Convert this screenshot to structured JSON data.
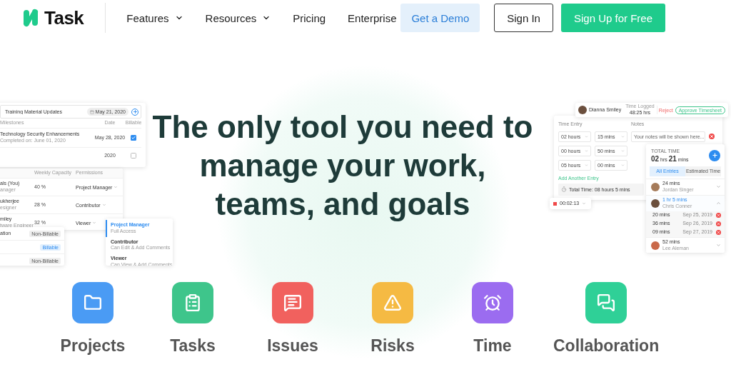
{
  "header": {
    "logo": {
      "text": "Task"
    },
    "nav": [
      {
        "label": "Features",
        "dropdown": true
      },
      {
        "label": "Resources",
        "dropdown": true
      },
      {
        "label": "Pricing",
        "dropdown": false
      },
      {
        "label": "Enterprise",
        "dropdown": false
      }
    ],
    "buttons": [
      {
        "label": "Get a Demo",
        "kind": "secondary"
      },
      {
        "label": "Sign In",
        "kind": "outline"
      },
      {
        "label": "Sign Up for Free",
        "kind": "primary"
      }
    ]
  },
  "hero": {
    "heading_lines": [
      "The only tool you need to",
      "manage your work,",
      "teams, and goals"
    ]
  },
  "left_mockup": {
    "milestones": {
      "task_field": "Training Material Updates",
      "date_chip": "May 21, 2020",
      "columns": [
        "Milestones",
        "Date",
        "Billable"
      ],
      "rows": [
        {
          "title": "Technology Security Enhancements",
          "subtitle": "Completed on: June 01, 2020",
          "date": "May 28, 2020",
          "billable": true
        },
        {
          "date": "2020",
          "billable": false
        }
      ]
    },
    "team": {
      "columns": [
        "Weekly Capacity",
        "Permissions"
      ],
      "rows": [
        {
          "name": "als (You)",
          "role": "anager",
          "capacity": "40 %",
          "permission": "Project Manager"
        },
        {
          "name": "ukherjee",
          "role": "esigner",
          "capacity": "28 %",
          "permission": "Contributor"
        },
        {
          "name": "miley",
          "role": "tware Engineer",
          "capacity": "32 %",
          "permission": "Viewer"
        }
      ]
    },
    "billing": [
      {
        "label": "ation",
        "badge": "Non-Billable",
        "billable": false
      },
      {
        "badge": "Billable",
        "billable": true
      },
      {
        "badge": "Non-Billable",
        "billable": false
      }
    ],
    "permission_menu": [
      {
        "title": "Project Manager",
        "description": "Full Access",
        "selected": true
      },
      {
        "title": "Contributor",
        "description": "Can Edit & Add Comments",
        "selected": false
      },
      {
        "title": "Viewer",
        "description": "Can View & Add Comments",
        "selected": false
      }
    ]
  },
  "right_mockup": {
    "approval": {
      "name": "Dianna Smiley",
      "logged_label": "Time Logged",
      "logged_value": "48:25 hrs",
      "reject": "Reject",
      "approve": "Approve Timesheet"
    },
    "entry_form": {
      "time_label": "Time Entry",
      "notes_label": "Notes",
      "rows": [
        {
          "hours": "02 hours",
          "mins": "15 mins"
        },
        {
          "hours": "00 hours",
          "mins": "50 mins"
        },
        {
          "hours": "05 hours",
          "mins": "00 mins"
        }
      ],
      "notes_placeholder": "Your notes will be shown here...",
      "add_entry": "Add Another Entry",
      "total": "Total Time: 08 hours 5 mins"
    },
    "timer": "00:02:13",
    "summary": {
      "label": "TOTAL TIME",
      "hours": "02",
      "hours_unit": "hrs",
      "mins": "21",
      "mins_unit": "mins",
      "tabs": [
        {
          "label": "All Entries",
          "selected": true
        },
        {
          "label": "Estimated Time",
          "selected": false
        }
      ],
      "entries": [
        {
          "duration": "24 mins",
          "name": "Jordan Singer",
          "expanded": false
        },
        {
          "duration": "1 hr 5 mins",
          "name": "Chris Conner",
          "expanded": true,
          "logs": [
            {
              "duration": "20 mins",
              "date": "Sep 25, 2019"
            },
            {
              "duration": "36 mins",
              "date": "Sep 26, 2019"
            },
            {
              "duration": "09 mins",
              "date": "Sep 27, 2019"
            }
          ]
        },
        {
          "duration": "52 mins",
          "name": "Lee Aleman",
          "expanded": false
        }
      ]
    }
  },
  "features": [
    {
      "label": "Projects",
      "kind": "folder",
      "color": "#4a9bf4"
    },
    {
      "label": "Tasks",
      "kind": "clipboard",
      "color": "#3ec58b"
    },
    {
      "label": "Issues",
      "kind": "note",
      "color": "#f1615e"
    },
    {
      "label": "Risks",
      "kind": "warning",
      "color": "#f5ba43"
    },
    {
      "label": "Time",
      "kind": "alarm",
      "color": "#9b6cf0"
    },
    {
      "label": "Collaboration",
      "kind": "chat",
      "color": "#2fd097"
    }
  ]
}
